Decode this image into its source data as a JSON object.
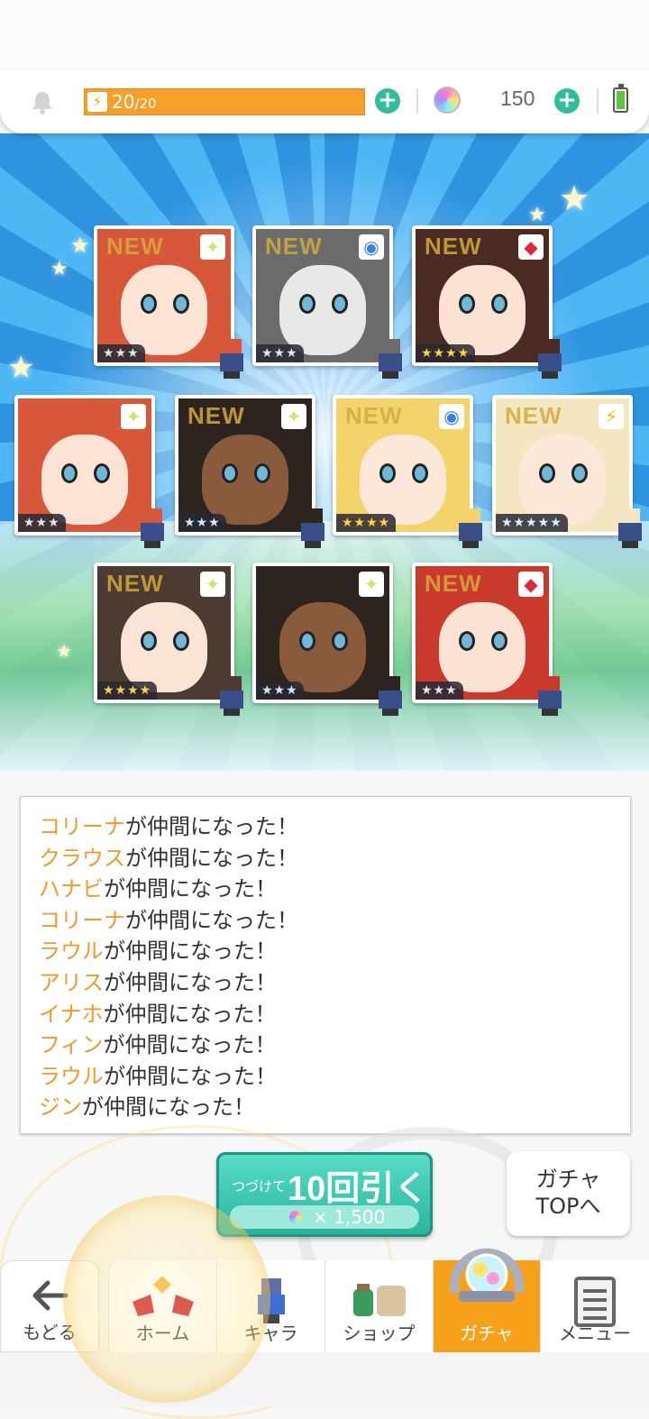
{
  "status": {
    "stamina_current": "20",
    "stamina_max": "/20",
    "stamina_fill": 1.0,
    "gems": "150",
    "icons": [
      "bell-icon",
      "lightning-icon",
      "plus-icon",
      "rainbow-orb-icon",
      "battery-icon"
    ]
  },
  "results": [
    {
      "new": "NEW",
      "element": "light",
      "element_icon": "✦",
      "rarity": "★★★",
      "rclass": "s3",
      "hair": "#d7573a",
      "skin": "#fde3d3"
    },
    {
      "new": "NEW",
      "element": "water",
      "element_icon": "◉",
      "rarity": "★★★",
      "rclass": "s3",
      "hair": "#6b6b6b",
      "skin": "#e8e8e8"
    },
    {
      "new": "NEW",
      "element": "fire",
      "element_icon": "◆",
      "rarity": "★★★★",
      "rclass": "s4",
      "hair": "#4a2a22",
      "skin": "#fbe2d2"
    },
    {
      "new": "",
      "element": "light",
      "element_icon": "✦",
      "rarity": "★★★",
      "rclass": "s3",
      "hair": "#d7573a",
      "skin": "#fde3d3"
    },
    {
      "new": "NEW",
      "element": "light",
      "element_icon": "✦",
      "rarity": "★★★",
      "rclass": "s3",
      "hair": "#2d241f",
      "skin": "#8a5a3c"
    },
    {
      "new": "NEW",
      "element": "water",
      "element_icon": "◉",
      "rarity": "★★★★",
      "rclass": "s4",
      "hair": "#f2d46a",
      "skin": "#fde7d8"
    },
    {
      "new": "NEW",
      "element": "thunder",
      "element_icon": "⚡",
      "rarity": "★★★★★",
      "rclass": "s5",
      "hair": "#f3e7c2",
      "skin": "#fde7d8"
    },
    {
      "new": "NEW",
      "element": "light",
      "element_icon": "✦",
      "rarity": "★★★★",
      "rclass": "s4",
      "hair": "#4b3b30",
      "skin": "#fbe4d6"
    },
    {
      "new": "",
      "element": "light",
      "element_icon": "✦",
      "rarity": "★★★",
      "rclass": "s3",
      "hair": "#2d241f",
      "skin": "#8a5a3c"
    },
    {
      "new": "NEW",
      "element": "fire",
      "element_icon": "◆",
      "rarity": "★★★",
      "rclass": "s3",
      "hair": "#c93a2c",
      "skin": "#fbe2d2"
    }
  ],
  "log": [
    {
      "name": "コリーナ",
      "text": "が仲間になった！"
    },
    {
      "name": "クラウス",
      "text": "が仲間になった！"
    },
    {
      "name": "ハナビ",
      "text": "が仲間になった！"
    },
    {
      "name": "コリーナ",
      "text": "が仲間になった！"
    },
    {
      "name": "ラウル",
      "text": "が仲間になった！"
    },
    {
      "name": "アリス",
      "text": "が仲間になった！"
    },
    {
      "name": "イナホ",
      "text": "が仲間になった！"
    },
    {
      "name": "フィン",
      "text": "が仲間になった！"
    },
    {
      "name": "ラウル",
      "text": "が仲間になった！"
    },
    {
      "name": "ジン",
      "text": "が仲間になった！"
    }
  ],
  "actions": {
    "pull_small": "つづけて",
    "pull_big": "10回引く",
    "pull_cost": "× 1,500",
    "top_line1": "ガチャ",
    "top_line2": "TOPへ"
  },
  "nav": [
    {
      "label": "もどる",
      "icon": "back-arrow-icon"
    },
    {
      "label": "ホーム",
      "icon": "home-icon"
    },
    {
      "label": "キャラ",
      "icon": "character-icon"
    },
    {
      "label": "ショップ",
      "icon": "shop-icon"
    },
    {
      "label": "ガチャ",
      "icon": "gacha-icon",
      "active": true
    },
    {
      "label": "メニュー",
      "icon": "menu-icon"
    }
  ],
  "colors": {
    "accent": "#f7a11a",
    "teal": "#2fbe9c",
    "name_orange": "#f09a2a"
  }
}
